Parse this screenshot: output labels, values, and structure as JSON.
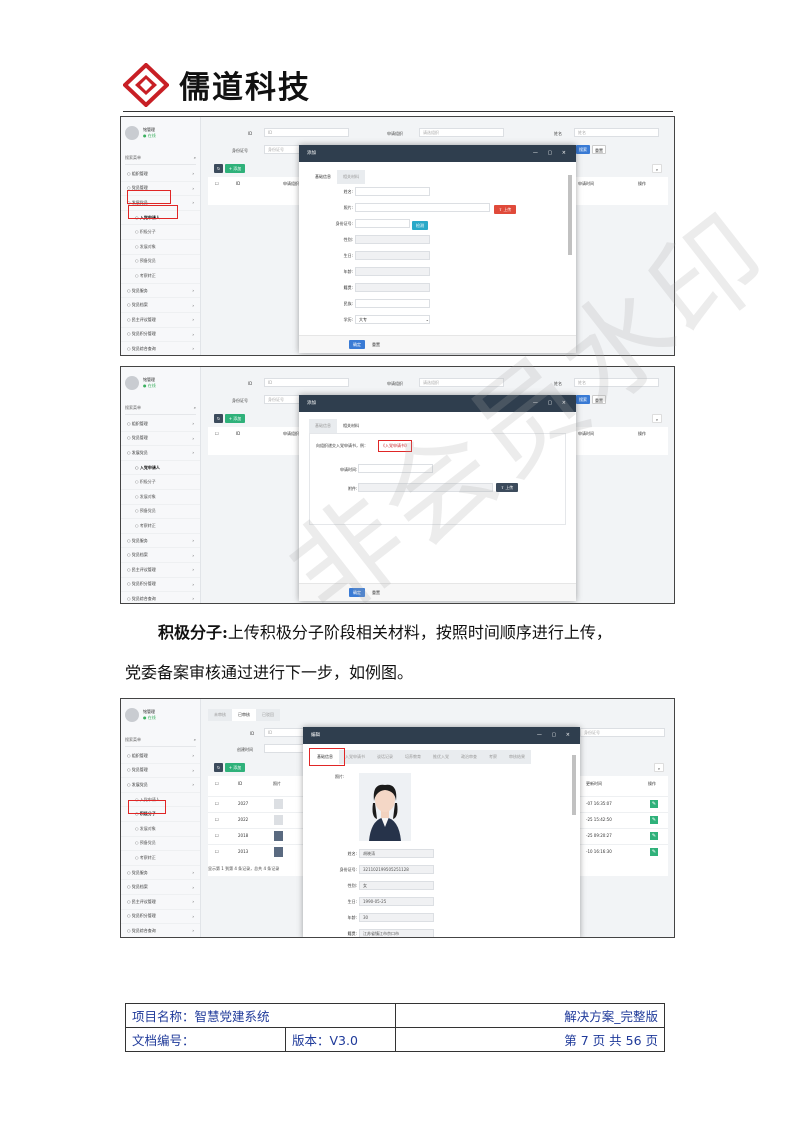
{
  "header": {
    "logo_text": "儒道科技"
  },
  "shot1": {
    "user": {
      "name": "铭管理",
      "status": "● 在线"
    },
    "search_placeholder": "搜索菜单",
    "menu": [
      {
        "label": "组织管理",
        "sub": false
      },
      {
        "label": "党员管理",
        "sub": false
      },
      {
        "label": "发展党员",
        "sub": false
      },
      {
        "label": "入党申请人",
        "sub": true
      },
      {
        "label": "积极分子",
        "sub": true
      },
      {
        "label": "发展对象",
        "sub": true
      },
      {
        "label": "预备党员",
        "sub": true
      },
      {
        "label": "考察转正",
        "sub": true
      },
      {
        "label": "党员服务",
        "sub": false
      },
      {
        "label": "党员档案",
        "sub": false
      },
      {
        "label": "民主评议管理",
        "sub": false
      },
      {
        "label": "党员积分管理",
        "sub": false
      },
      {
        "label": "党员综合查询",
        "sub": false
      }
    ],
    "filters": {
      "id": "ID",
      "org": "申请组织",
      "name": "姓名",
      "idcard": "身份证号"
    },
    "placeholders": {
      "id": "ID",
      "org": "请选组织",
      "name": "姓名",
      "idcard": "身份证号"
    },
    "buttons": {
      "add": "+ 添加",
      "search": "搜索",
      "reset": "重置"
    },
    "table_headers": [
      "ID",
      "申请组织",
      "申请时间",
      "操作"
    ],
    "modal": {
      "title": "添加",
      "tabs": [
        "基础信息",
        "相关材料"
      ],
      "fields": [
        "姓名:",
        "照片:",
        "身份证号:",
        "性别:",
        "生日:",
        "年龄:",
        "籍贯:",
        "民族:",
        "学历:"
      ],
      "upload": "上传",
      "check": "检测",
      "education_value": "大专",
      "confirm": "确定",
      "reset": "重置"
    }
  },
  "shot2": {
    "modal": {
      "title": "添加",
      "tabs": [
        "基础信息",
        "相关材料"
      ],
      "hint": "向组织递交入党申请书，例：",
      "link": "《入党申请书》",
      "date_label": "申请时间:",
      "attach_label": "附件:",
      "upload": "上传",
      "confirm": "确定",
      "reset": "重置"
    }
  },
  "body": {
    "p1_bold": "积极分子:",
    "p1": "上传积极分子阶段相关材料，按照时间顺序进行上传，",
    "p2": "党委备案审核通过进行下一步，如例图。"
  },
  "shot3": {
    "tabs_top": [
      "未审核",
      "已审核",
      "已驳回"
    ],
    "filters": {
      "id": "ID",
      "created": "创建时间",
      "idcard": "身份证号"
    },
    "table_headers": [
      "ID",
      "照片",
      "更新时间",
      "操作"
    ],
    "rows": [
      {
        "id": "2027",
        "time": "-07 16:35:07"
      },
      {
        "id": "2022",
        "time": "-25 15:42:50"
      },
      {
        "id": "2018",
        "time": "-25 09:20:27"
      },
      {
        "id": "2013",
        "time": "-10 16:16:30"
      }
    ],
    "pager": "显示第 1 到第 4 条记录，总共 4 条记录",
    "modal": {
      "title": "编辑",
      "tabs": [
        "基础信息",
        "入党申请书",
        "谈话记录",
        "培养教育",
        "推优入党",
        "政治审查",
        "考察",
        "审核结果"
      ],
      "photo_label": "照片:",
      "fields": [
        {
          "label": "姓名:",
          "value": "胡晓涛"
        },
        {
          "label": "身份证号:",
          "value": "321102199505251128"
        },
        {
          "label": "性别:",
          "value": "女"
        },
        {
          "label": "生日:",
          "value": "1990-05-25"
        },
        {
          "label": "年龄:",
          "value": "30"
        },
        {
          "label": "籍贯:",
          "value": "江苏省镇江市京口市"
        }
      ]
    }
  },
  "footer": {
    "project_label": "项目名称：智慧党建系统",
    "solution": "解决方案_完整版",
    "doc_no": "文档编号：",
    "version": "版本：V3.0",
    "page": "第 7 页 共 56 页"
  },
  "watermark": "非会员水印",
  "colors": {
    "accent_red": "#e02626",
    "sidebar_dark": "#2f3e4e",
    "primary": "#3a7bd5",
    "success": "#2fb17a",
    "footer_text": "#1f3a9a"
  }
}
